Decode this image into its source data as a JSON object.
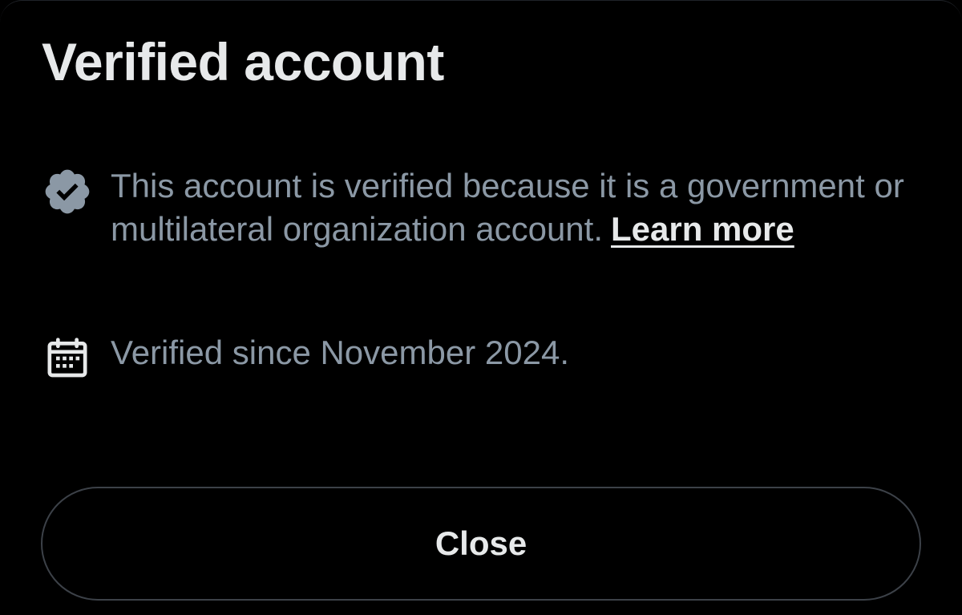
{
  "sheet": {
    "title": "Verified account"
  },
  "verified_row": {
    "icon": "verified-badge-icon",
    "badge_color": "#8b98a5",
    "text": "This account is verified because it is a government or multilateral organization account.",
    "link_label": "Learn more"
  },
  "since_row": {
    "icon": "calendar-icon",
    "text": "Verified since November 2024."
  },
  "footer": {
    "close_label": "Close"
  },
  "colors": {
    "background": "#000000",
    "primary_text": "#e7e9ea",
    "secondary_text": "#8b98a5",
    "button_border": "#3c4148"
  }
}
